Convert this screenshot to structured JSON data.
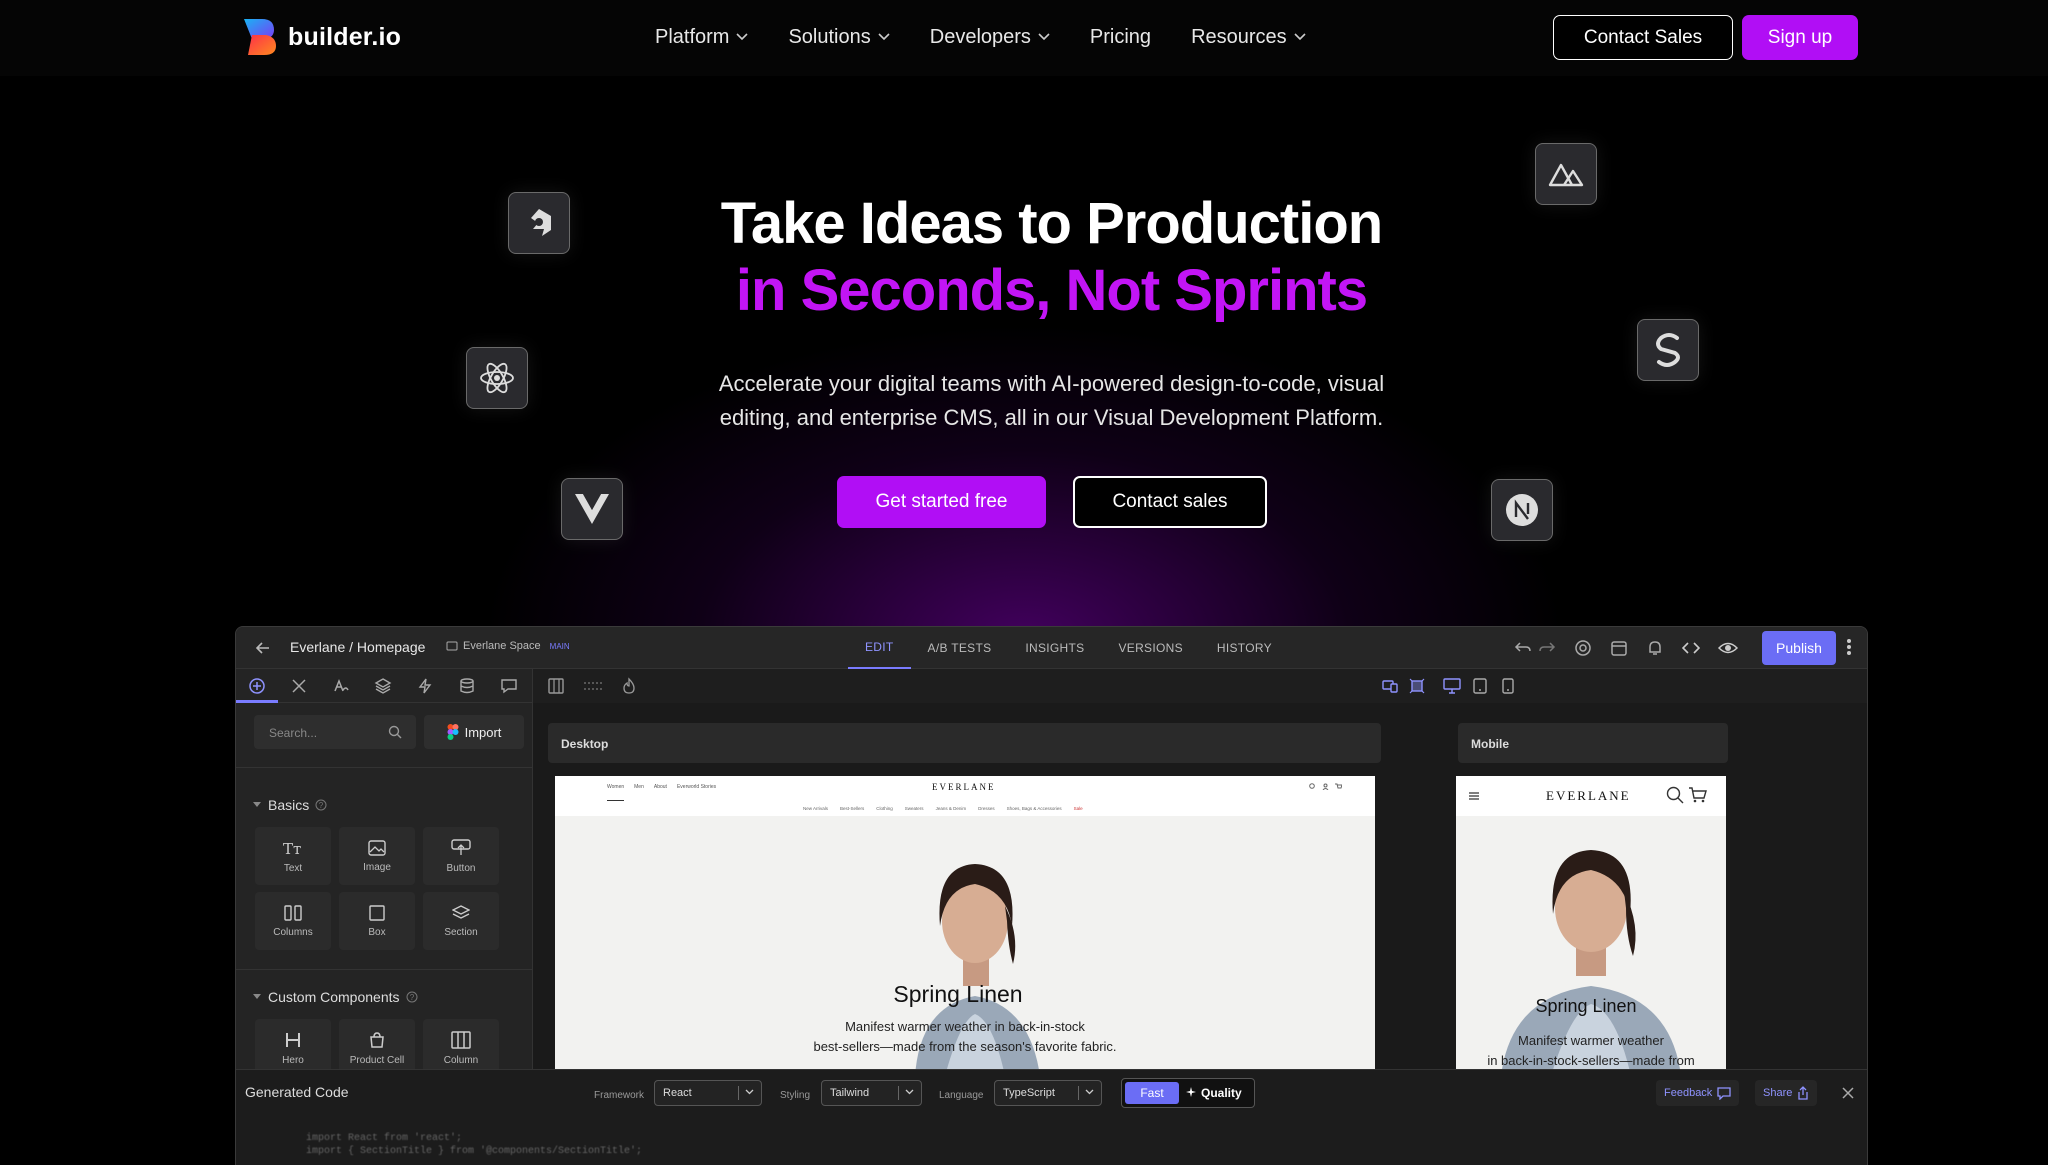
{
  "brand": {
    "name": "builder.io"
  },
  "nav": {
    "items": [
      {
        "label": "Platform",
        "dropdown": true
      },
      {
        "label": "Solutions",
        "dropdown": true
      },
      {
        "label": "Developers",
        "dropdown": true
      },
      {
        "label": "Pricing",
        "dropdown": false
      },
      {
        "label": "Resources",
        "dropdown": true
      }
    ],
    "contact_sales": "Contact Sales",
    "sign_up": "Sign up"
  },
  "hero": {
    "title_line1": "Take Ideas to Production",
    "title_line2": "in Seconds, Not Sprints",
    "subtitle_line1": "Accelerate your digital teams with AI-powered design-to-code, visual",
    "subtitle_line2": "editing, and enterprise CMS, all in our Visual Development Platform.",
    "cta_primary": "Get started free",
    "cta_secondary": "Contact sales"
  },
  "framework_icons": [
    "qwik-icon",
    "react-icon",
    "vue-icon",
    "nuxt-icon",
    "svelte-icon",
    "next-icon"
  ],
  "editor": {
    "breadcrumb": "Everlane / Homepage",
    "space": "Everlane Space",
    "space_badge": "MAIN",
    "tabs": [
      "EDIT",
      "A/B TESTS",
      "INSIGHTS",
      "VERSIONS",
      "HISTORY"
    ],
    "active_tab": "EDIT",
    "publish": "Publish",
    "search_placeholder": "Search...",
    "import": "Import",
    "basics_title": "Basics",
    "basics": [
      "Text",
      "Image",
      "Button",
      "Columns",
      "Box",
      "Section"
    ],
    "custom_title": "Custom Components",
    "custom": [
      "Hero",
      "Product Cell",
      "Column"
    ],
    "desktop_label": "Desktop",
    "mobile_label": "Mobile",
    "site": {
      "brand": "EVERLANE",
      "nav_left": [
        "Women",
        "Men",
        "About",
        "Everworld Stories"
      ],
      "categories": [
        "New Arrivals",
        "Best-Sellers",
        "Clothing",
        "Sweaters",
        "Jeans & Denim",
        "Dresses",
        "Shoes, Bags & Accessories",
        "Sale"
      ],
      "headline": "Spring Linen",
      "desktop_copy_line1": "Manifest warmer weather in back-in-stock",
      "desktop_copy_line2": "best-sellers—made from the season's favorite fabric.",
      "mobile_copy_line1": "Manifest warmer weather",
      "mobile_copy_line2": "in back-in-stock-sellers—made from"
    },
    "code_panel": {
      "title": "Generated Code",
      "framework_label": "Framework",
      "framework_value": "React",
      "styling_label": "Styling",
      "styling_value": "Tailwind",
      "language_label": "Language",
      "language_value": "TypeScript",
      "fast": "Fast",
      "quality": "Quality",
      "feedback": "Feedback",
      "share": "Share",
      "code_line1": "import React from 'react';",
      "code_line2": "import { SectionTitle } from '@components/SectionTitle';"
    }
  },
  "colors": {
    "accent": "#b10ef5",
    "editor_accent": "#6b6df5",
    "headline_purple": "#c215f5"
  }
}
